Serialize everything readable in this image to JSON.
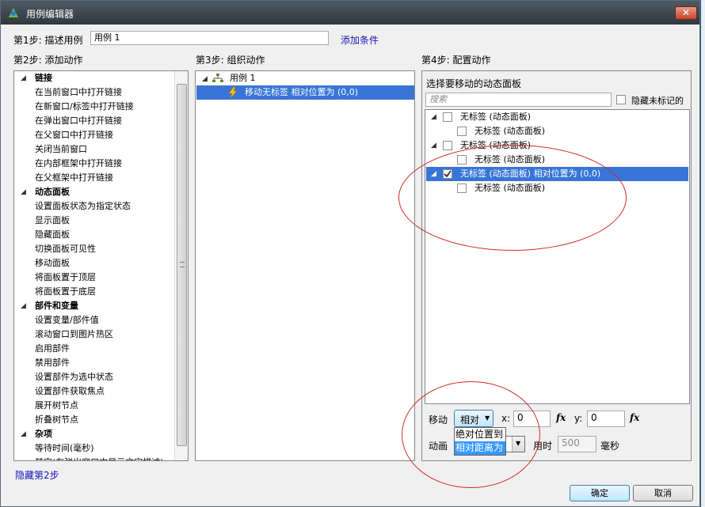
{
  "window": {
    "title": "用例编辑器",
    "close_label": "✕"
  },
  "step1": {
    "label": "第1步: 描述用例",
    "case_name": "用例 1",
    "add_condition": "添加条件"
  },
  "step2": {
    "label": "第2步: 添加动作",
    "hide_link": "隐藏第2步",
    "categories": [
      {
        "name": "链接",
        "items": [
          "在当前窗口中打开链接",
          "在新窗口/标签中打开链接",
          "在弹出窗口中打开链接",
          "在父窗口中打开链接",
          "关闭当前窗口",
          "在内部框架中打开链接",
          "在父框架中打开链接"
        ]
      },
      {
        "name": "动态面板",
        "items": [
          "设置面板状态为指定状态",
          "显示面板",
          "隐藏面板",
          "切换面板可见性",
          "移动面板",
          "将面板置于顶层",
          "将面板置于底层"
        ]
      },
      {
        "name": "部件和变量",
        "items": [
          "设置变量/部件值",
          "滚动窗口到图片热区",
          "启用部件",
          "禁用部件",
          "设置部件为选中状态",
          "设置部件获取焦点",
          "展开树节点",
          "折叠树节点"
        ]
      },
      {
        "name": "杂项",
        "items": [
          "等待时间(毫秒)",
          "其它(在弹出窗口中显示文字描述)"
        ]
      }
    ]
  },
  "step3": {
    "label": "第3步: 组织动作",
    "case": "用例 1",
    "action": "移动无标签 相对位置为 (0,0)"
  },
  "step4": {
    "label": "第4步: 配置动作",
    "panel_title": "选择要移动的动态面板",
    "search_placeholder": "搜索",
    "hide_unlabeled": "隐藏未标记的",
    "tree": [
      {
        "label": "无标签 (动态面板)",
        "child": "无标签 (动态面板)",
        "checked": false
      },
      {
        "label": "无标签 (动态面板)",
        "child": "无标签 (动态面板)",
        "checked": false
      },
      {
        "label": "无标签 (动态面板) 相对位置为 (0,0)",
        "child": "无标签 (动态面板)",
        "checked": true
      }
    ],
    "move_label": "移动",
    "move_mode": "相对",
    "x_label": "x:",
    "x_value": "0",
    "y_label": "y:",
    "y_value": "0",
    "fx": "fx",
    "anim_label": "动画",
    "time_label": "用时",
    "time_value": "500",
    "ms_label": "毫秒",
    "dropdown_options": [
      "绝对位置到",
      "相对距离为"
    ]
  },
  "buttons": {
    "ok": "确定",
    "cancel": "取消"
  }
}
